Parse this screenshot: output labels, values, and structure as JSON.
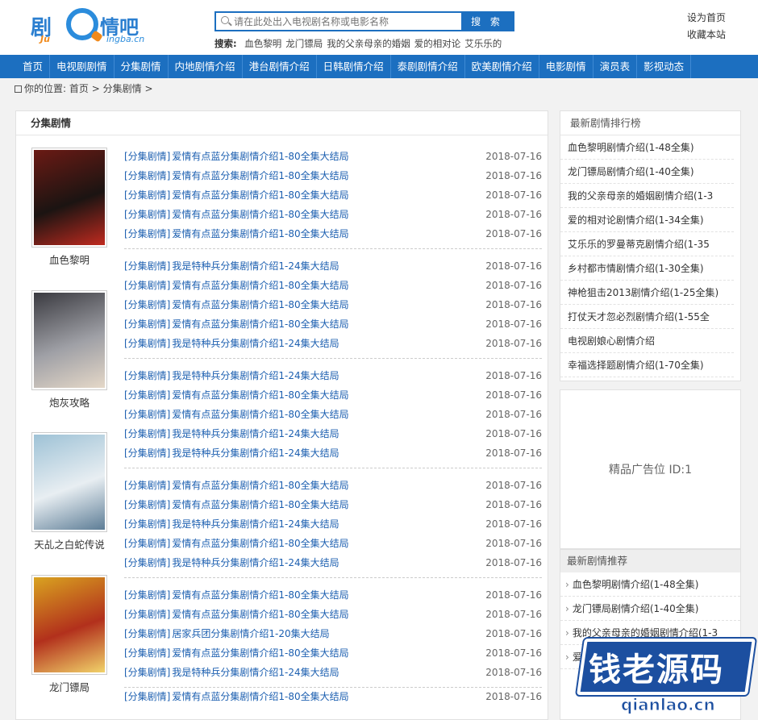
{
  "site": {
    "logo_text_left": "剧",
    "logo_text_right": "情吧",
    "logo_sub_left": "Ju",
    "logo_sub_right": "ingba.cn"
  },
  "search": {
    "placeholder": "请在此处出入电视剧名称或电影名称",
    "button": "搜 索",
    "hot_label": "搜索:",
    "hot_keywords": [
      "血色黎明",
      "龙门镖局",
      "我的父亲母亲的婚姻",
      "爱的相对论",
      "艾乐乐的"
    ]
  },
  "toplinks": {
    "home": "设为首页",
    "fav": "收藏本站"
  },
  "nav": [
    "首页",
    "电视剧剧情",
    "分集剧情",
    "内地剧情介绍",
    "港台剧情介绍",
    "日韩剧情介绍",
    "泰剧剧情介绍",
    "欧美剧情介绍",
    "电影剧情",
    "演员表",
    "影视动态"
  ],
  "breadcrumb": {
    "prefix": "你的位置:",
    "home": "首页",
    "sep1": ">",
    "current": "分集剧情",
    "sep2": ">"
  },
  "main": {
    "title": "分集剧情",
    "blocks": [
      {
        "name": "血色黎明",
        "rows": [
          {
            "cat": "[分集剧情]",
            "title": "爱情有点蓝分集剧情介绍1-80全集大结局",
            "date": "2018-07-16"
          },
          {
            "cat": "[分集剧情]",
            "title": "爱情有点蓝分集剧情介绍1-80全集大结局",
            "date": "2018-07-16"
          },
          {
            "cat": "[分集剧情]",
            "title": "爱情有点蓝分集剧情介绍1-80全集大结局",
            "date": "2018-07-16"
          },
          {
            "cat": "[分集剧情]",
            "title": "爱情有点蓝分集剧情介绍1-80全集大结局",
            "date": "2018-07-16"
          },
          {
            "cat": "[分集剧情]",
            "title": "爱情有点蓝分集剧情介绍1-80全集大结局",
            "date": "2018-07-16"
          }
        ]
      },
      {
        "name": "",
        "rows": [
          {
            "cat": "[分集剧情]",
            "title": "我是特种兵分集剧情介绍1-24集大结局",
            "date": "2018-07-16"
          },
          {
            "cat": "[分集剧情]",
            "title": "爱情有点蓝分集剧情介绍1-80全集大结局",
            "date": "2018-07-16"
          },
          {
            "cat": "[分集剧情]",
            "title": "爱情有点蓝分集剧情介绍1-80全集大结局",
            "date": "2018-07-16"
          },
          {
            "cat": "[分集剧情]",
            "title": "爱情有点蓝分集剧情介绍1-80全集大结局",
            "date": "2018-07-16"
          },
          {
            "cat": "[分集剧情]",
            "title": "我是特种兵分集剧情介绍1-24集大结局",
            "date": "2018-07-16"
          }
        ]
      },
      {
        "name": "炮灰攻略",
        "rows": [
          {
            "cat": "[分集剧情]",
            "title": "我是特种兵分集剧情介绍1-24集大结局",
            "date": "2018-07-16"
          },
          {
            "cat": "[分集剧情]",
            "title": "爱情有点蓝分集剧情介绍1-80全集大结局",
            "date": "2018-07-16"
          },
          {
            "cat": "[分集剧情]",
            "title": "爱情有点蓝分集剧情介绍1-80全集大结局",
            "date": "2018-07-16"
          },
          {
            "cat": "[分集剧情]",
            "title": "我是特种兵分集剧情介绍1-24集大结局",
            "date": "2018-07-16"
          },
          {
            "cat": "[分集剧情]",
            "title": "我是特种兵分集剧情介绍1-24集大结局",
            "date": "2018-07-16"
          }
        ]
      },
      {
        "name": "天乩之白蛇传说",
        "rows": [
          {
            "cat": "[分集剧情]",
            "title": "爱情有点蓝分集剧情介绍1-80全集大结局",
            "date": "2018-07-16"
          },
          {
            "cat": "[分集剧情]",
            "title": "爱情有点蓝分集剧情介绍1-80全集大结局",
            "date": "2018-07-16"
          },
          {
            "cat": "[分集剧情]",
            "title": "我是特种兵分集剧情介绍1-24集大结局",
            "date": "2018-07-16"
          },
          {
            "cat": "[分集剧情]",
            "title": "爱情有点蓝分集剧情介绍1-80全集大结局",
            "date": "2018-07-16"
          },
          {
            "cat": "[分集剧情]",
            "title": "我是特种兵分集剧情介绍1-24集大结局",
            "date": "2018-07-16"
          }
        ]
      },
      {
        "name": "龙门镖局",
        "rows": [
          {
            "cat": "[分集剧情]",
            "title": "爱情有点蓝分集剧情介绍1-80全集大结局",
            "date": "2018-07-16"
          },
          {
            "cat": "[分集剧情]",
            "title": "爱情有点蓝分集剧情介绍1-80全集大结局",
            "date": "2018-07-16"
          },
          {
            "cat": "[分集剧情]",
            "title": "居家兵团分集剧情介绍1-20集大结局",
            "date": "2018-07-16"
          },
          {
            "cat": "[分集剧情]",
            "title": "爱情有点蓝分集剧情介绍1-80全集大结局",
            "date": "2018-07-16"
          },
          {
            "cat": "[分集剧情]",
            "title": "我是特种兵分集剧情介绍1-24集大结局",
            "date": "2018-07-16"
          }
        ]
      },
      {
        "name": "",
        "rows": [
          {
            "cat": "[分集剧情]",
            "title": "爱情有点蓝分集剧情介绍1-80全集大结局",
            "date": "2018-07-16"
          }
        ]
      }
    ]
  },
  "ranking": {
    "title": "最新剧情排行榜",
    "items": [
      "血色黎明剧情介绍(1-48全集)",
      "龙门镖局剧情介绍(1-40全集)",
      "我的父亲母亲的婚姻剧情介绍(1-3",
      "爱的相对论剧情介绍(1-34全集)",
      "艾乐乐的罗曼蒂克剧情介绍(1-35",
      "乡村都市情剧情介绍(1-30全集)",
      "神枪狙击2013剧情介绍(1-25全集)",
      "打仗天才忽必烈剧情介绍(1-55全",
      "电视剧娘心剧情介绍",
      "幸福选择题剧情介绍(1-70全集)"
    ]
  },
  "ad": {
    "text": "精品广告位 ID:1"
  },
  "recommend": {
    "title": "最新剧情推荐",
    "items": [
      "血色黎明剧情介绍(1-48全集)",
      "龙门镖局剧情介绍(1-40全集)",
      "我的父亲母亲的婚姻剧情介绍(1-3",
      "爱"
    ]
  },
  "watermark": {
    "text": "钱老源码",
    "url": "qianlao.cn"
  },
  "colors": {
    "primary": "#1c6fc0",
    "link": "#1c5fb0",
    "accent": "#f08a1c"
  }
}
